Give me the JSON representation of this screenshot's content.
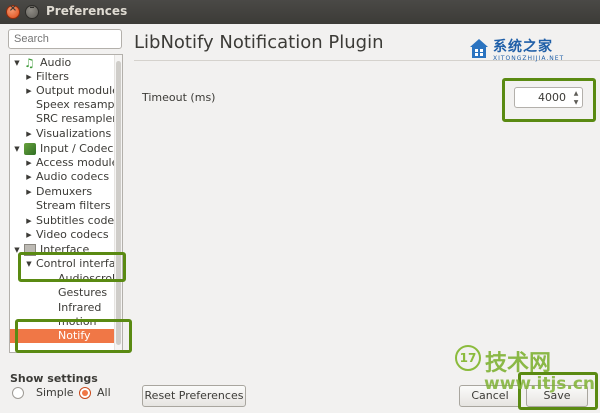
{
  "window": {
    "title": "Preferences",
    "close_glyph": "×",
    "minimize_glyph": "–"
  },
  "sidebar": {
    "search_placeholder": "Search",
    "tree": [
      {
        "label": "Audio",
        "arrow": "▼",
        "icon": "music-note-icon"
      },
      {
        "label": "Filters",
        "arrow": "▶"
      },
      {
        "label": "Output modules",
        "arrow": "▶"
      },
      {
        "label": "Speex resampler"
      },
      {
        "label": "SRC resampler"
      },
      {
        "label": "Visualizations",
        "arrow": "▶"
      },
      {
        "label": "Input / Codecs",
        "arrow": "▼",
        "icon": "input-codecs-icon"
      },
      {
        "label": "Access modules",
        "arrow": "▶"
      },
      {
        "label": "Audio codecs",
        "arrow": "▶"
      },
      {
        "label": "Demuxers",
        "arrow": "▶"
      },
      {
        "label": "Stream filters"
      },
      {
        "label": "Subtitles codecs",
        "arrow": "▶"
      },
      {
        "label": "Video codecs",
        "arrow": "▶"
      },
      {
        "label": "Interface",
        "arrow": "▼",
        "icon": "interface-icon"
      },
      {
        "label": "Control interfaces",
        "arrow": "▼"
      },
      {
        "label": "Audioscrobbler"
      },
      {
        "label": "Gestures"
      },
      {
        "label": "Infrared"
      },
      {
        "label": "motion"
      },
      {
        "label": "Notify",
        "selected": true
      }
    ]
  },
  "show_settings": {
    "label": "Show settings",
    "simple": "Simple",
    "all": "All",
    "selected": "All"
  },
  "main": {
    "heading": "LibNotify Notification Plugin",
    "timeout_label": "Timeout (ms)",
    "timeout_value": "4000",
    "spin_up": "▲",
    "spin_down": "▼"
  },
  "buttons": {
    "reset": "Reset Preferences",
    "cancel": "Cancel",
    "save": "Save"
  },
  "watermarks": {
    "top_logo_text": "系统之家",
    "top_logo_sub": "XITONGZHIJIA.NET",
    "bottom_logo_badge": "17",
    "bottom_logo_text": "技术网",
    "bottom_logo_url": "www.itjs.cn"
  },
  "colors": {
    "selection": "#f07746",
    "highlight_box": "#5a8a12",
    "titlebar": "#3c3b37"
  }
}
